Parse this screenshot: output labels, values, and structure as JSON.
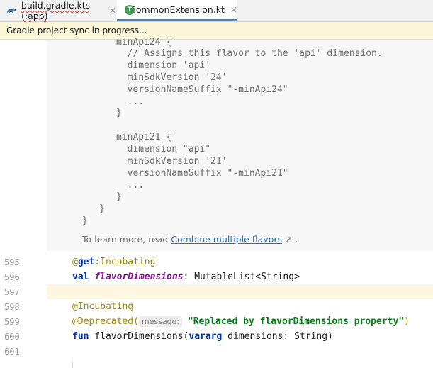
{
  "tabs": [
    {
      "label": "build.gradle.kts (:app)",
      "icon": "gradle-icon",
      "active": false
    },
    {
      "label": "CommonExtension.kt",
      "icon": "kotlin-file-icon",
      "active": true
    }
  ],
  "banner": {
    "text": "Gradle project sync in progress..."
  },
  "doc": {
    "lines": [
      "minApi24 {",
      "  // Assigns this flavor to the 'api' dimension.",
      "  dimension 'api'",
      "  minSdkVersion '24'",
      "  versionNameSuffix \"-minApi24\"",
      "  ...",
      "}",
      "",
      "minApi21 {",
      "  dimension \"api\"",
      "  minSdkVersion '21'",
      "  versionNameSuffix \"-minApi21\"",
      "  ...",
      "}",
      "}",
      "}"
    ],
    "learn_prefix": "To learn more, read ",
    "learn_link": "Combine multiple flavors",
    "learn_suffix": " ↗ ."
  },
  "line_numbers": [
    "595",
    "596",
    "597",
    "598",
    "599",
    "600",
    "601"
  ],
  "code": {
    "l595_at": "@",
    "l595_get": "get",
    "l595_rest": ":Incubating",
    "l596_val": "val",
    "l596_name": "flavorDimensions",
    "l596_type": ": MutableList<String>",
    "l598": "@Incubating",
    "l599_anno": "@Deprecated(",
    "l599_hint": "message:",
    "l599_str": "\"Replaced by flavorDimensions property\"",
    "l599_close": ")",
    "l600_fun": "fun",
    "l600_name": " flavorDimensions(",
    "l600_vararg": "vararg",
    "l600_rest": " dimensions: String)"
  },
  "colors": {
    "accent": "#4083c9",
    "banner_bg": "#fbf6d8",
    "keyword": "#0033b3",
    "string": "#067d17",
    "annotation": "#9e880d",
    "property": "#871094"
  }
}
